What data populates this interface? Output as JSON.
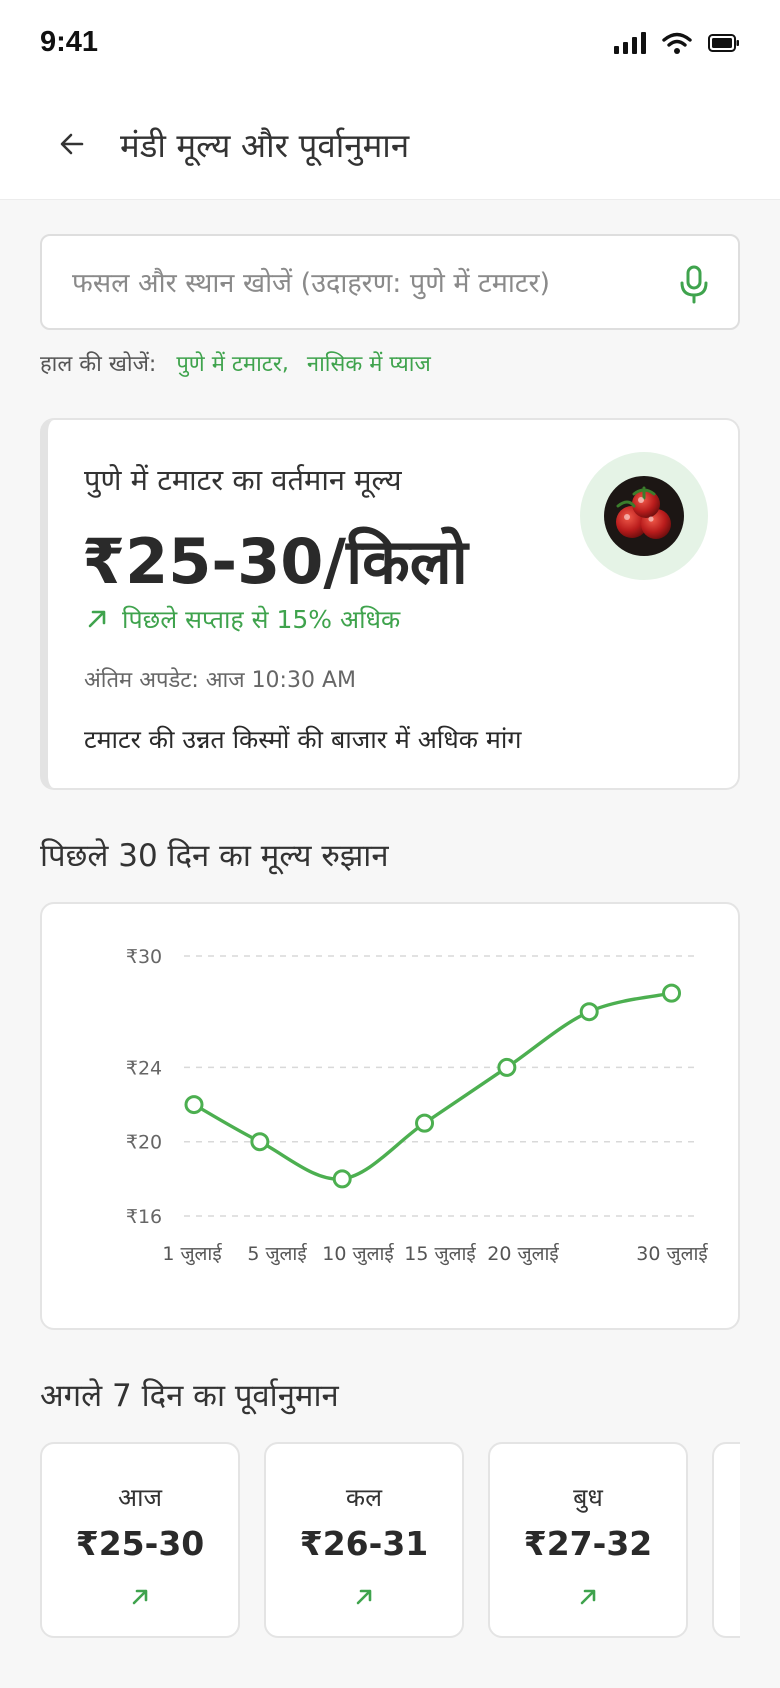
{
  "status": {
    "time": "9:41"
  },
  "header": {
    "title": "मंडी मूल्य और पूर्वानुमान"
  },
  "search": {
    "placeholder": "फसल और स्थान खोजें (उदाहरण: पुणे में टमाटर)",
    "value": ""
  },
  "recent": {
    "label": "हाल की खोजें:",
    "items": [
      "पुणे में टमाटर",
      "नासिक में प्याज"
    ],
    "separator": ","
  },
  "current": {
    "heading": "पुणे में टमाटर का वर्तमान मूल्य",
    "price": "₹25-30/किलो",
    "change": "पिछले सप्ताह से 15% अधिक",
    "updated": "अंतिम अपडेट: आज 10:30 AM",
    "note": "टमाटर की उन्नत किस्मों की बाजार में अधिक मांग"
  },
  "trend": {
    "title": "पिछले 30 दिन का मूल्य रुझान"
  },
  "chart_data": {
    "type": "line",
    "title": "",
    "xlabel": "",
    "ylabel": "",
    "x_tick_labels": [
      "1 जुलाई",
      "5 जुलाई",
      "10 जुलाई",
      "15 जुलाई",
      "20 जुलाई",
      "30 जुलाई"
    ],
    "y_ticks": [
      {
        "value": 30,
        "label": "₹30"
      },
      {
        "value": 24,
        "label": "₹24"
      },
      {
        "value": 20,
        "label": "₹20"
      },
      {
        "value": 16,
        "label": "₹16"
      }
    ],
    "ylim": [
      16,
      30
    ],
    "x": [
      1,
      5,
      10,
      15,
      20,
      25,
      30
    ],
    "values": [
      22,
      20,
      18,
      21,
      24,
      27,
      28
    ],
    "grid": true,
    "line_color": "#4caf50"
  },
  "forecast": {
    "title": "अगले 7 दिन का पूर्वानुमान",
    "days": [
      {
        "day": "आज",
        "price": "₹25-30",
        "trend": "up"
      },
      {
        "day": "कल",
        "price": "₹26-31",
        "trend": "up"
      },
      {
        "day": "बुध",
        "price": "₹27-32",
        "trend": "up"
      }
    ]
  },
  "colors": {
    "accent": "#3fa34d",
    "accent_light": "#e5f3e6",
    "text": "#2a2a2a"
  }
}
